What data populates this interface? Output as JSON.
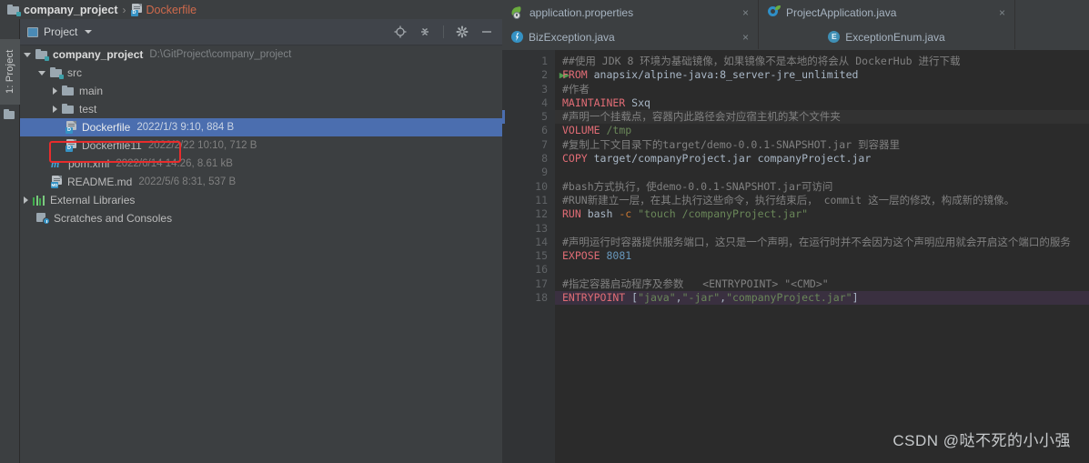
{
  "breadcrumb": {
    "project_icon": "folder-icon",
    "project": "company_project",
    "separator": "›",
    "file_icon": "dockerfile-icon",
    "file": "Dockerfile"
  },
  "stripe": {
    "tool_window_label": "1: Project",
    "folder_icon": "folder-icon"
  },
  "project_panel": {
    "title": "Project",
    "title_icon": "project-view-icon",
    "caret": "chevron-down-icon",
    "tools": [
      "locate-icon",
      "collapse-all-icon",
      "settings-gear-icon",
      "hide-icon"
    ],
    "tree": [
      {
        "indent": 0,
        "arrow": "down",
        "icon": "folder-icon",
        "label": "company_project",
        "bold": true,
        "meta": "D:\\GitProject\\company_project",
        "meta_kind": "path",
        "selected": false
      },
      {
        "indent": 1,
        "arrow": "down",
        "icon": "folder-icon",
        "label": "src",
        "bold": false,
        "meta": "",
        "meta_kind": "",
        "selected": false
      },
      {
        "indent": 2,
        "arrow": "right",
        "icon": "folder-icon",
        "label": "main",
        "bold": false,
        "meta": "",
        "meta_kind": "",
        "selected": false
      },
      {
        "indent": 2,
        "arrow": "right",
        "icon": "folder-icon",
        "label": "test",
        "bold": false,
        "meta": "",
        "meta_kind": "",
        "selected": false
      },
      {
        "indent": 2,
        "arrow": "none",
        "icon": "dockerfile-icon",
        "label": "Dockerfile",
        "bold": false,
        "meta": "2022/1/3 9:10, 884 B",
        "meta_kind": "info",
        "selected": true
      },
      {
        "indent": 2,
        "arrow": "none",
        "icon": "dockerfile-icon",
        "label": "Dockerfile11",
        "bold": false,
        "meta": "2022/2/22 10:10, 712 B",
        "meta_kind": "info",
        "selected": false
      },
      {
        "indent": 1,
        "arrow": "none",
        "icon": "maven-icon",
        "label": "pom.xml",
        "bold": false,
        "meta": "2022/6/14 14:26, 8.61 kB",
        "meta_kind": "info",
        "selected": false
      },
      {
        "indent": 1,
        "arrow": "none",
        "icon": "markdown-icon",
        "label": "README.md",
        "bold": false,
        "meta": "2022/5/6 8:31, 537 B",
        "meta_kind": "info",
        "selected": false
      },
      {
        "indent": 0,
        "arrow": "right",
        "icon": "libraries-icon",
        "label": "External Libraries",
        "bold": false,
        "meta": "",
        "meta_kind": "",
        "selected": false
      },
      {
        "indent": 0,
        "arrow": "none",
        "icon": "scratches-icon",
        "label": "Scratches and Consoles",
        "bold": false,
        "meta": "",
        "meta_kind": "",
        "selected": false
      }
    ]
  },
  "annotation": {
    "shape": "red-rectangle",
    "color": "#e82c2c"
  },
  "editor": {
    "tab_rows": [
      [
        {
          "label": "application.properties",
          "icon": "spring-properties-icon",
          "close": "×",
          "active": false
        },
        {
          "label": "ProjectApplication.java",
          "icon": "spring-application-icon",
          "close": "×",
          "active": false
        }
      ],
      [
        {
          "label": "BizException.java",
          "icon": "java-class-icon",
          "close": "×",
          "active": false
        },
        {
          "label": "ExceptionEnum.java",
          "icon": "java-enum-icon",
          "close": "",
          "active": false
        }
      ]
    ],
    "lines": [
      {
        "n": 1,
        "run": false,
        "current": false,
        "entry": false,
        "tokens": [
          {
            "t": "cmt",
            "v": "##使用 JDK 8 环境为基础镜像，如果镜像不是本地的将会从 DockerHub 进行下载"
          }
        ]
      },
      {
        "n": 2,
        "run": true,
        "current": false,
        "entry": false,
        "tokens": [
          {
            "t": "kw2",
            "v": "FROM "
          },
          {
            "t": "txt",
            "v": "anapsix/alpine-java:8_server-jre_unlimited"
          }
        ]
      },
      {
        "n": 3,
        "run": false,
        "current": false,
        "entry": false,
        "tokens": [
          {
            "t": "cmt",
            "v": "#作者"
          }
        ]
      },
      {
        "n": 4,
        "run": false,
        "current": false,
        "entry": false,
        "tokens": [
          {
            "t": "kw2",
            "v": "MAINTAINER "
          },
          {
            "t": "txt",
            "v": "Sxq"
          }
        ]
      },
      {
        "n": 5,
        "run": false,
        "current": true,
        "entry": false,
        "tokens": [
          {
            "t": "cmt",
            "v": "#声明一个挂载点，容器内此路径会对应宿主机的某个文件夹"
          }
        ]
      },
      {
        "n": 6,
        "run": false,
        "current": false,
        "entry": false,
        "tokens": [
          {
            "t": "kw2",
            "v": "VOLUME "
          },
          {
            "t": "str",
            "v": "/tmp"
          }
        ]
      },
      {
        "n": 7,
        "run": false,
        "current": false,
        "entry": false,
        "tokens": [
          {
            "t": "cmt",
            "v": "#复制上下文目录下的target/demo-0.0.1-SNAPSHOT.jar 到容器里"
          }
        ]
      },
      {
        "n": 8,
        "run": false,
        "current": false,
        "entry": false,
        "tokens": [
          {
            "t": "kw2",
            "v": "COPY "
          },
          {
            "t": "txt",
            "v": "target/companyProject.jar companyProject.jar"
          }
        ]
      },
      {
        "n": 9,
        "run": false,
        "current": false,
        "entry": false,
        "tokens": [
          {
            "t": "txt",
            "v": ""
          }
        ]
      },
      {
        "n": 10,
        "run": false,
        "current": false,
        "entry": false,
        "tokens": [
          {
            "t": "cmt",
            "v": "#bash方式执行，使demo-0.0.1-SNAPSHOT.jar可访问"
          }
        ]
      },
      {
        "n": 11,
        "run": false,
        "current": false,
        "entry": false,
        "tokens": [
          {
            "t": "cmt",
            "v": "#RUN新建立一层，在其上执行这些命令，执行结束后， commit 这一层的修改，构成新的镜像。"
          }
        ]
      },
      {
        "n": 12,
        "run": false,
        "current": false,
        "entry": false,
        "tokens": [
          {
            "t": "kw2",
            "v": "RUN "
          },
          {
            "t": "txt",
            "v": "bash "
          },
          {
            "t": "kw",
            "v": "-c "
          },
          {
            "t": "str",
            "v": "\"touch /companyProject.jar\""
          }
        ]
      },
      {
        "n": 13,
        "run": false,
        "current": false,
        "entry": false,
        "tokens": [
          {
            "t": "txt",
            "v": ""
          }
        ]
      },
      {
        "n": 14,
        "run": false,
        "current": false,
        "entry": false,
        "tokens": [
          {
            "t": "cmt",
            "v": "#声明运行时容器提供服务端口，这只是一个声明，在运行时并不会因为这个声明应用就会开启这个端口的服务"
          }
        ]
      },
      {
        "n": 15,
        "run": false,
        "current": false,
        "entry": false,
        "tokens": [
          {
            "t": "kw2",
            "v": "EXPOSE "
          },
          {
            "t": "num",
            "v": "8081"
          }
        ]
      },
      {
        "n": 16,
        "run": false,
        "current": false,
        "entry": false,
        "tokens": [
          {
            "t": "txt",
            "v": ""
          }
        ]
      },
      {
        "n": 17,
        "run": false,
        "current": false,
        "entry": false,
        "tokens": [
          {
            "t": "cmt",
            "v": "#指定容器启动程序及参数   <ENTRYPOINT> \"<CMD>\""
          }
        ]
      },
      {
        "n": 18,
        "run": false,
        "current": false,
        "entry": true,
        "tokens": [
          {
            "t": "kw2",
            "v": "ENTRYPOINT "
          },
          {
            "t": "txt",
            "v": "["
          },
          {
            "t": "str",
            "v": "\"java\""
          },
          {
            "t": "txt",
            "v": ","
          },
          {
            "t": "str",
            "v": "\"-jar\""
          },
          {
            "t": "txt",
            "v": ","
          },
          {
            "t": "str",
            "v": "\"companyProject.jar\""
          },
          {
            "t": "txt",
            "v": "]"
          }
        ]
      }
    ]
  },
  "watermark": "CSDN @哒不死的小小强"
}
